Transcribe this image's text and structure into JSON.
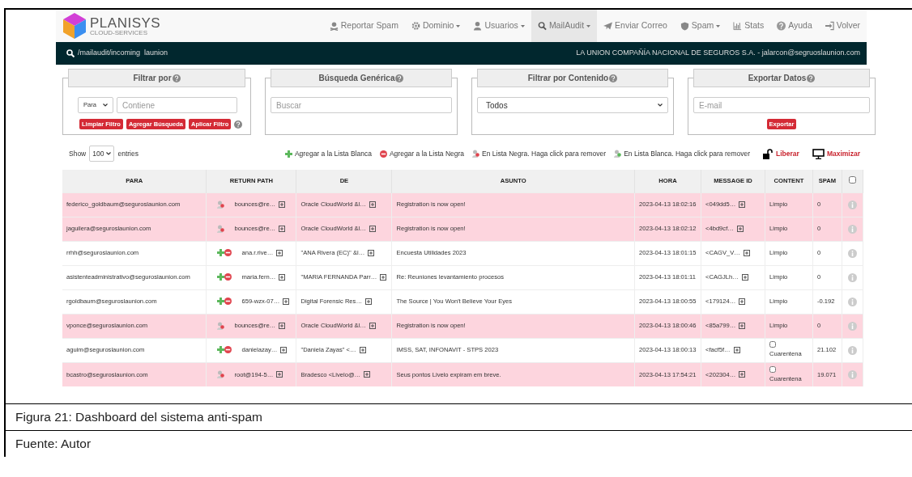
{
  "brand": {
    "name": "PLANISYS",
    "tagline": "CLOUD-SERVICES"
  },
  "nav": [
    {
      "label": "Reportar Spam",
      "dropdown": false,
      "selected": false
    },
    {
      "label": "Dominio",
      "dropdown": true,
      "selected": false
    },
    {
      "label": "Usuarios",
      "dropdown": true,
      "selected": false
    },
    {
      "label": "MailAudit",
      "dropdown": true,
      "selected": true
    },
    {
      "label": "Enviar Correo",
      "dropdown": false,
      "selected": false
    },
    {
      "label": "Spam",
      "dropdown": true,
      "selected": false
    },
    {
      "label": "Stats",
      "dropdown": false,
      "selected": false
    },
    {
      "label": "Ayuda",
      "dropdown": false,
      "selected": false
    },
    {
      "label": "Volver",
      "dropdown": false,
      "selected": false
    }
  ],
  "path_bar": {
    "path": "/mailaudit/incoming  launion",
    "account": "LA UNION COMPAÑÍA NACIONAL DE SEGUROS S.A. - jalarcon@segruoslaunion.com"
  },
  "panels": [
    {
      "title": "Filtrar por",
      "kind": "filter",
      "select": "Para",
      "placeholder": "Contiene",
      "buttons": [
        "Limpiar Filtro",
        "Agregar Búsqueda",
        "Aplicar Filtro"
      ]
    },
    {
      "title": "Búsqueda Genérica",
      "kind": "search",
      "placeholder": "Buscar"
    },
    {
      "title": "Filtrar por Contenido",
      "kind": "select",
      "value": "Todos"
    },
    {
      "title": "Exportar Datos",
      "kind": "export",
      "placeholder": "E-mail",
      "buttons": [
        "Exportar"
      ]
    }
  ],
  "entries": {
    "show": "Show",
    "value": "100",
    "suffix": "entries"
  },
  "legend": [
    {
      "label": "Agregar a la Lista Blanca",
      "kind": "add"
    },
    {
      "label": "Agregar a la Lista Negra",
      "kind": "remove"
    },
    {
      "label": "En Lista Negra. Haga click para remover",
      "kind": "blacklisted"
    },
    {
      "label": "En Lista Blanca. Haga click para remover",
      "kind": "whitelisted"
    },
    {
      "label": "Liberar",
      "kind": "unlock"
    },
    {
      "label": "Maximizar",
      "kind": "maximize"
    }
  ],
  "table": {
    "columns": [
      "PARA",
      "RETURN PATH",
      "DE",
      "ASUNTO",
      "HORA",
      "MESSAGE ID",
      "CONTENT",
      "SPAM"
    ],
    "select_all_checked": false,
    "rows": [
      {
        "kind": "blacklisted",
        "para": "federico_goldbaum@seguroslaunion.com",
        "return_path": "bounces@re…",
        "de": "Oracle CloudWorld &l…",
        "asunto": "Registration is now open!",
        "hora": "2023-04-13 18:02:16",
        "message_id": "<049dd5…",
        "content": {
          "kind": "clean",
          "label": "Limpio"
        },
        "spam": "0"
      },
      {
        "kind": "blacklisted",
        "para": "jaguilera@seguroslaunion.com",
        "return_path": "bounces@re…",
        "de": "Oracle CloudWorld &l…",
        "asunto": "Registration is now open!",
        "hora": "2023-04-13 18:02:12",
        "message_id": "<4bd9cf…",
        "content": {
          "kind": "clean",
          "label": "Limpio"
        },
        "spam": "0"
      },
      {
        "kind": "unlisted",
        "para": "rrhh@seguroslaunion.com",
        "return_path": "ana.r.rive…",
        "de": "\"ANA Rivera (EC)\" &l…",
        "asunto": "Encuesta Utilidades 2023",
        "hora": "2023-04-13 18:01:15",
        "message_id": "<CAGV_V…",
        "content": {
          "kind": "clean",
          "label": "Limpio"
        },
        "spam": "0"
      },
      {
        "kind": "unlisted",
        "para": "asistenteadministrativo@seguroslaunion.com",
        "return_path": "maria.fern…",
        "de": "\"MARIA FERNANDA Parr…",
        "asunto": "Re: Reuniones levantamiento procesos",
        "hora": "2023-04-13 18:01:11",
        "message_id": "<CAGJLh…",
        "content": {
          "kind": "clean",
          "label": "Limpio"
        },
        "spam": "0"
      },
      {
        "kind": "unlisted",
        "para": "rgoldbaum@seguroslaunion.com",
        "return_path": "659-wzx-07…",
        "de": "Digital Forensic Res…",
        "asunto": "The Source | You Won't Believe Your Eyes",
        "hora": "2023-04-13 18:00:55",
        "message_id": "<179124…",
        "content": {
          "kind": "clean",
          "label": "Limpio"
        },
        "spam": "-0.192"
      },
      {
        "kind": "blacklisted",
        "para": "vponce@seguroslaunion.com",
        "return_path": "bounces@re…",
        "de": "Oracle CloudWorld &l…",
        "asunto": "Registration is now open!",
        "hora": "2023-04-13 18:00:46",
        "message_id": "<85a799…",
        "content": {
          "kind": "clean",
          "label": "Limpio"
        },
        "spam": "0"
      },
      {
        "kind": "unlisted",
        "para": "aguim@seguroslaunion.com",
        "return_path": "danielazay…",
        "de": "\"Daniela Zayas\" <…",
        "asunto": "IMSS, SAT, INFONAVIT - STPS 2023",
        "hora": "2023-04-13 18:00:13",
        "message_id": "<facf5f…",
        "content": {
          "kind": "quarantine",
          "label": "Cuarentena",
          "checked": false
        },
        "spam": "21.102"
      },
      {
        "kind": "blacklisted",
        "para": "bcastro@seguroslaunion.com",
        "return_path": "root@194-5…",
        "de": "Bradesco <Livelo@…",
        "asunto": "Seus pontos Livelo expiram em breve.",
        "hora": "2023-04-13 17:54:21",
        "message_id": "<202304…",
        "content": {
          "kind": "quarantine",
          "label": "Cuarentena",
          "checked": false
        },
        "spam": "19.071"
      }
    ]
  },
  "caption": [
    "Figura 21: Dashboard del sistema anti-spam",
    "Fuente: Autor"
  ]
}
